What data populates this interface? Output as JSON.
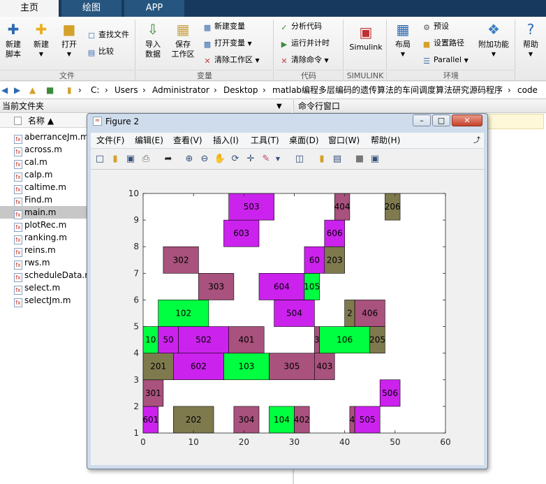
{
  "tabs": [
    "主页",
    "绘图",
    "APP"
  ],
  "ribbon": {
    "new_script": "新建\n脚本",
    "new": "新建",
    "open": "打开",
    "find_files": "查找文件",
    "compare": "比较",
    "import_data": "导入\n数据",
    "save_workspace": "保存\n工作区",
    "new_variable": "新建变量",
    "open_variable": "打开变量",
    "clear_workspace": "清除工作区",
    "analyze_code": "分析代码",
    "run_time": "运行并计时",
    "clear_commands": "清除命令",
    "simulink": "Simulink",
    "layout": "布局",
    "preferences": "预设",
    "set_path": "设置路径",
    "parallel": "Parallel",
    "addons": "附加功能",
    "help": "帮助",
    "groups": [
      "文件",
      "变量",
      "代码",
      "SIMULINK",
      "环境"
    ]
  },
  "address": {
    "path": [
      "C:",
      "Users",
      "Administrator",
      "Desktop",
      "matlab编程多层编码的遗传算法的车间调度算法研究源码程序",
      "code"
    ]
  },
  "left_pane": {
    "title": "当前文件夹",
    "column": "名称 ▲",
    "files": [
      "aberranceJm.m",
      "across.m",
      "cal.m",
      "calp.m",
      "caltime.m",
      "Find.m",
      "main.m",
      "plotRec.m",
      "ranking.m",
      "reins.m",
      "rws.m",
      "scheduleData.m",
      "select.m",
      "selectJm.m"
    ],
    "selected": "main.m"
  },
  "right_pane": {
    "title": "命令行窗口"
  },
  "figure": {
    "title": "Figure 2",
    "menu": [
      "文件(F)",
      "编辑(E)",
      "查看(V)",
      "插入(I)",
      "工具(T)",
      "桌面(D)",
      "窗口(W)",
      "帮助(H)"
    ],
    "tools": [
      "new-icon",
      "open-icon",
      "save-icon",
      "print-icon",
      "pointer-icon",
      "zoom-in-icon",
      "zoom-out-icon",
      "pan-icon",
      "rotate-icon",
      "data-cursor-icon",
      "brush-icon",
      "link-icon",
      "colorbar-icon",
      "legend-icon",
      "hide-tools-icon",
      "dock-icon"
    ]
  },
  "colors": {
    "green": "#00ff40",
    "magenta": "#cc22ee",
    "mauve": "#a8527d",
    "olive": "#7e7a4e",
    "tab_bar": "#17395d"
  },
  "chart_data": {
    "type": "gantt",
    "xlim": [
      0,
      60
    ],
    "ylim": [
      1,
      10
    ],
    "xticks": [
      0,
      10,
      20,
      30,
      40,
      50,
      60
    ],
    "yticks": [
      1,
      2,
      3,
      4,
      5,
      6,
      7,
      8,
      9,
      10
    ],
    "bars": [
      {
        "label": "601",
        "machine": 1,
        "start": 0,
        "end": 3,
        "color": "magenta"
      },
      {
        "label": "202",
        "machine": 1,
        "start": 6,
        "end": 14,
        "color": "olive"
      },
      {
        "label": "304",
        "machine": 1,
        "start": 18,
        "end": 23,
        "color": "mauve"
      },
      {
        "label": "104",
        "machine": 1,
        "start": 25,
        "end": 30,
        "color": "green"
      },
      {
        "label": "402",
        "machine": 1,
        "start": 30,
        "end": 33,
        "color": "mauve"
      },
      {
        "label": "4",
        "machine": 1,
        "start": 41,
        "end": 42,
        "color": "mauve"
      },
      {
        "label": "505",
        "machine": 1,
        "start": 42,
        "end": 47,
        "color": "magenta"
      },
      {
        "label": "506",
        "machine": 2,
        "start": 47,
        "end": 51,
        "color": "magenta"
      },
      {
        "label": "301",
        "machine": 2,
        "start": 0,
        "end": 4,
        "color": "mauve"
      },
      {
        "label": "201",
        "machine": 3,
        "start": 0,
        "end": 6,
        "color": "olive"
      },
      {
        "label": "602",
        "machine": 3,
        "start": 6,
        "end": 16,
        "color": "magenta"
      },
      {
        "label": "103",
        "machine": 3,
        "start": 16,
        "end": 25,
        "color": "green"
      },
      {
        "label": "305",
        "machine": 3,
        "start": 25,
        "end": 34,
        "color": "mauve"
      },
      {
        "label": "403",
        "machine": 3,
        "start": 34,
        "end": 38,
        "color": "mauve"
      },
      {
        "label": "10",
        "machine": 4,
        "start": 0,
        "end": 3,
        "color": "green"
      },
      {
        "label": "50",
        "machine": 4,
        "start": 3,
        "end": 7,
        "color": "magenta"
      },
      {
        "label": "502",
        "machine": 4,
        "start": 7,
        "end": 17,
        "color": "magenta"
      },
      {
        "label": "401",
        "machine": 4,
        "start": 17,
        "end": 24,
        "color": "mauve"
      },
      {
        "label": "3",
        "machine": 4,
        "start": 34,
        "end": 35,
        "color": "mauve"
      },
      {
        "label": "106",
        "machine": 4,
        "start": 35,
        "end": 45,
        "color": "green"
      },
      {
        "label": "205",
        "machine": 4,
        "start": 45,
        "end": 48,
        "color": "olive"
      },
      {
        "label": "102",
        "machine": 5,
        "start": 3,
        "end": 13,
        "color": "green"
      },
      {
        "label": "504",
        "machine": 5,
        "start": 26,
        "end": 34,
        "color": "magenta"
      },
      {
        "label": "2",
        "machine": 5,
        "start": 40,
        "end": 42,
        "color": "olive"
      },
      {
        "label": "406",
        "machine": 5,
        "start": 42,
        "end": 48,
        "color": "mauve"
      },
      {
        "label": "303",
        "machine": 6,
        "start": 11,
        "end": 18,
        "color": "mauve"
      },
      {
        "label": "604",
        "machine": 6,
        "start": 23,
        "end": 32,
        "color": "magenta"
      },
      {
        "label": "105",
        "machine": 6,
        "start": 32,
        "end": 35,
        "color": "green"
      },
      {
        "label": "302",
        "machine": 7,
        "start": 4,
        "end": 11,
        "color": "mauve"
      },
      {
        "label": "60",
        "machine": 7,
        "start": 32,
        "end": 36,
        "color": "magenta"
      },
      {
        "label": "203",
        "machine": 7,
        "start": 36,
        "end": 40,
        "color": "olive"
      },
      {
        "label": "603",
        "machine": 8,
        "start": 16,
        "end": 23,
        "color": "magenta"
      },
      {
        "label": "606",
        "machine": 8,
        "start": 36,
        "end": 40,
        "color": "magenta"
      },
      {
        "label": "503",
        "machine": 9,
        "start": 17,
        "end": 26,
        "color": "magenta"
      },
      {
        "label": "404",
        "machine": 9,
        "start": 38,
        "end": 41,
        "color": "mauve"
      },
      {
        "label": "206",
        "machine": 9,
        "start": 48,
        "end": 51,
        "color": "olive"
      }
    ]
  }
}
